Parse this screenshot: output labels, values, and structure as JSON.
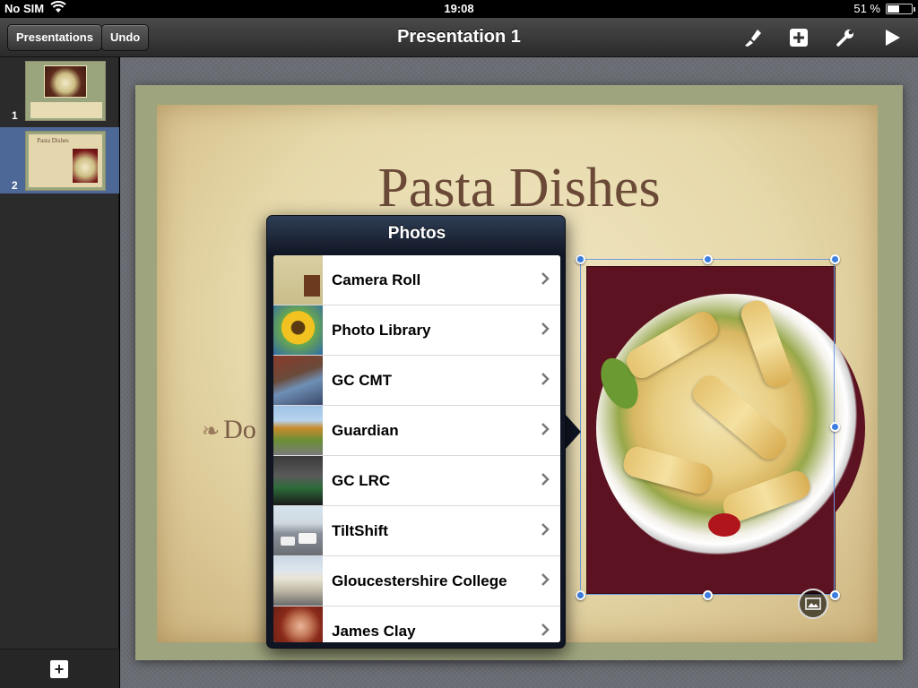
{
  "status": {
    "carrier": "No SIM",
    "time": "19:08",
    "battery": "51 %",
    "battery_level": 0.51
  },
  "toolbar": {
    "presentations_label": "Presentations",
    "undo_label": "Undo",
    "title": "Presentation 1",
    "icons": [
      "paintbrush-icon",
      "add-icon",
      "wrench-icon",
      "play-icon"
    ]
  },
  "sidebar": {
    "slides": [
      {
        "number": "1",
        "selected": false
      },
      {
        "number": "2",
        "selected": true,
        "caption": "Pasta Dishes"
      }
    ]
  },
  "slide": {
    "title": "Pasta Dishes",
    "bullet": "Do"
  },
  "popover": {
    "title": "Photos",
    "albums": [
      {
        "label": "Camera Roll",
        "thumb": "slide-thumb"
      },
      {
        "label": "Photo Library",
        "thumb": "sunflower"
      },
      {
        "label": "GC CMT",
        "thumb": "street"
      },
      {
        "label": "Guardian",
        "thumb": "trees"
      },
      {
        "label": "GC LRC",
        "thumb": "library"
      },
      {
        "label": "TiltShift",
        "thumb": "cars"
      },
      {
        "label": "Gloucestershire College",
        "thumb": "building"
      },
      {
        "label": "James Clay",
        "thumb": "portrait"
      }
    ]
  },
  "colors": {
    "selection": "#4d6896",
    "handle": "#3d7fe0",
    "title_text": "#6a4937"
  }
}
